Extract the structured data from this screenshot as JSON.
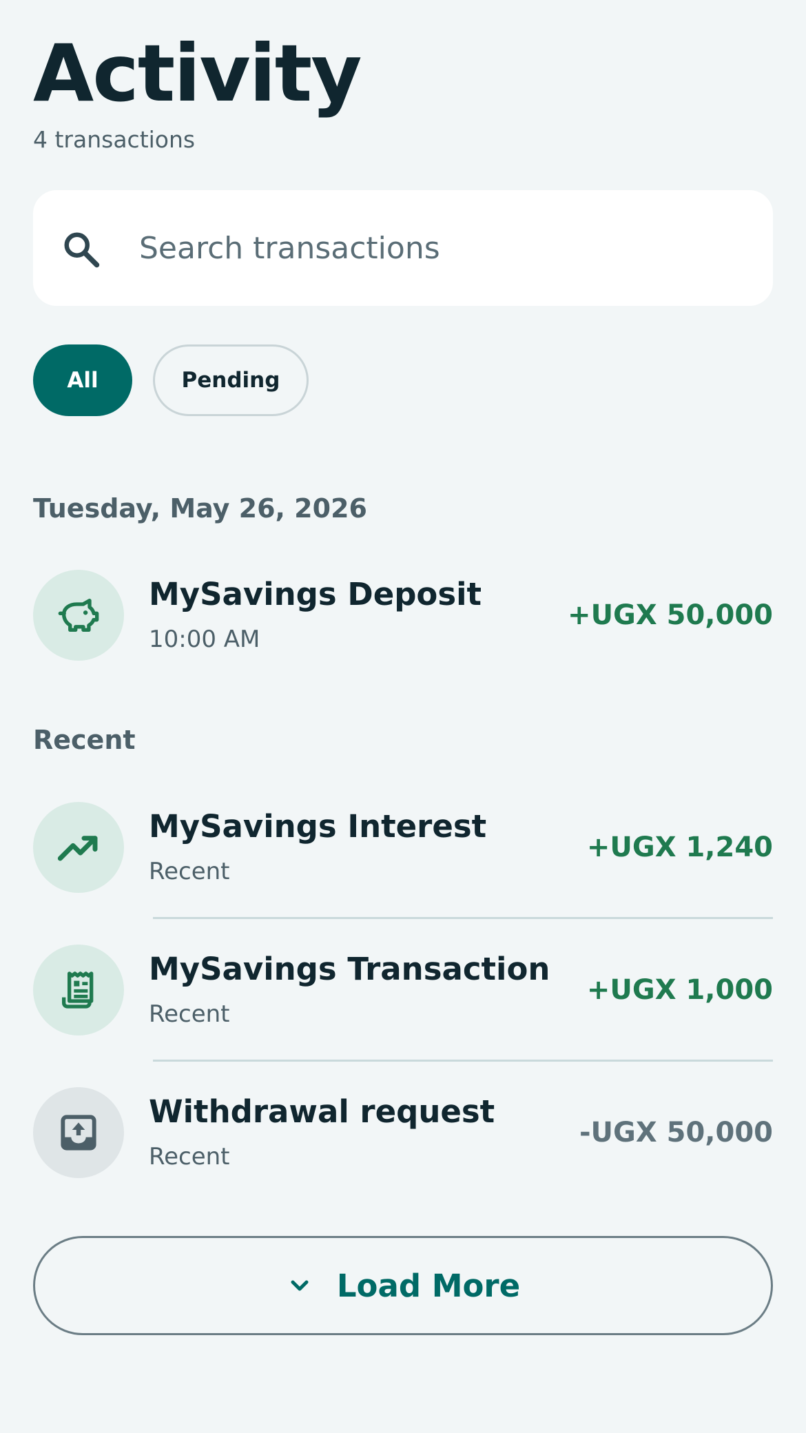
{
  "header": {
    "title": "Activity",
    "count_text": "4 transactions"
  },
  "search": {
    "placeholder": "Search transactions",
    "value": ""
  },
  "filters": {
    "items": [
      {
        "label": "All",
        "selected": true
      },
      {
        "label": "Pending",
        "selected": false
      }
    ]
  },
  "sections": [
    {
      "title": "Tuesday, May 26, 2026",
      "transactions": [
        {
          "name": "MySavings Deposit",
          "subtitle": "10:00 AM",
          "amount": "+UGX 50,000",
          "type": "credit",
          "icon": "piggy-bank-icon"
        }
      ]
    },
    {
      "title": "Recent",
      "transactions": [
        {
          "name": "MySavings Interest",
          "subtitle": "Recent",
          "amount": "+UGX 1,240",
          "type": "credit",
          "icon": "trending-up-icon"
        },
        {
          "name": "MySavings Transaction",
          "subtitle": "Recent",
          "amount": "+UGX 1,000",
          "type": "credit",
          "icon": "receipt-icon"
        },
        {
          "name": "Withdrawal request",
          "subtitle": "Recent",
          "amount": "-UGX 50,000",
          "type": "debit",
          "icon": "outbox-upload-icon"
        }
      ]
    }
  ],
  "load_more": {
    "label": "Load More",
    "icon": "chevron-down-icon"
  },
  "colors": {
    "background": "#f2f6f7",
    "accent": "#006a66",
    "credit": "#1f7a4f",
    "debit": "#5f727b",
    "text_primary": "#10262f",
    "text_secondary": "#4c5f68"
  }
}
